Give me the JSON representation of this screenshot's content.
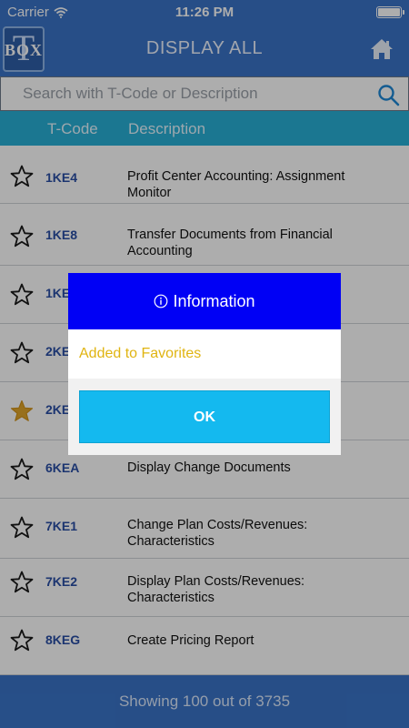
{
  "status_bar": {
    "carrier": "Carrier",
    "time": "11:26 PM"
  },
  "header": {
    "logo_letter_big": "T",
    "logo_letter_small": "BOX",
    "title": "DISPLAY ALL",
    "home_icon": "home-icon"
  },
  "search": {
    "placeholder": "Search with T-Code or Description",
    "icon": "search-icon"
  },
  "columns": {
    "code": "T-Code",
    "description": "Description"
  },
  "rows": [
    {
      "code": "1KE4",
      "description": "Profit Center Accounting: Assignment Monitor",
      "favorite": false
    },
    {
      "code": "1KE8",
      "description": "Transfer Documents from Financial Accounting",
      "favorite": false
    },
    {
      "code": "1KE",
      "description": "",
      "favorite": false
    },
    {
      "code": "2KE",
      "description": "",
      "favorite": false
    },
    {
      "code": "2KE",
      "description": "",
      "favorite": true
    },
    {
      "code": "6KEA",
      "description": "Display Change Documents",
      "favorite": false
    },
    {
      "code": "7KE1",
      "description": "Change Plan Costs/Revenues: Characteristics",
      "favorite": false
    },
    {
      "code": "7KE2",
      "description": "Display Plan Costs/Revenues: Characteristics",
      "favorite": false
    },
    {
      "code": "8KEG",
      "description": "Create Pricing Report",
      "favorite": false
    }
  ],
  "footer": {
    "text": "Showing 100 out of 3735"
  },
  "dialog": {
    "title": "Information",
    "message": "Added to Favorites",
    "ok_label": "OK",
    "title_icon": "info-icon"
  },
  "colors": {
    "header_blue": "#3a74c8",
    "column_bar": "#29b0d6",
    "dialog_header": "#0000f5",
    "ok_button": "#14b9ef",
    "message_text": "#e0b411",
    "favorite_star": "#e0a52a"
  }
}
